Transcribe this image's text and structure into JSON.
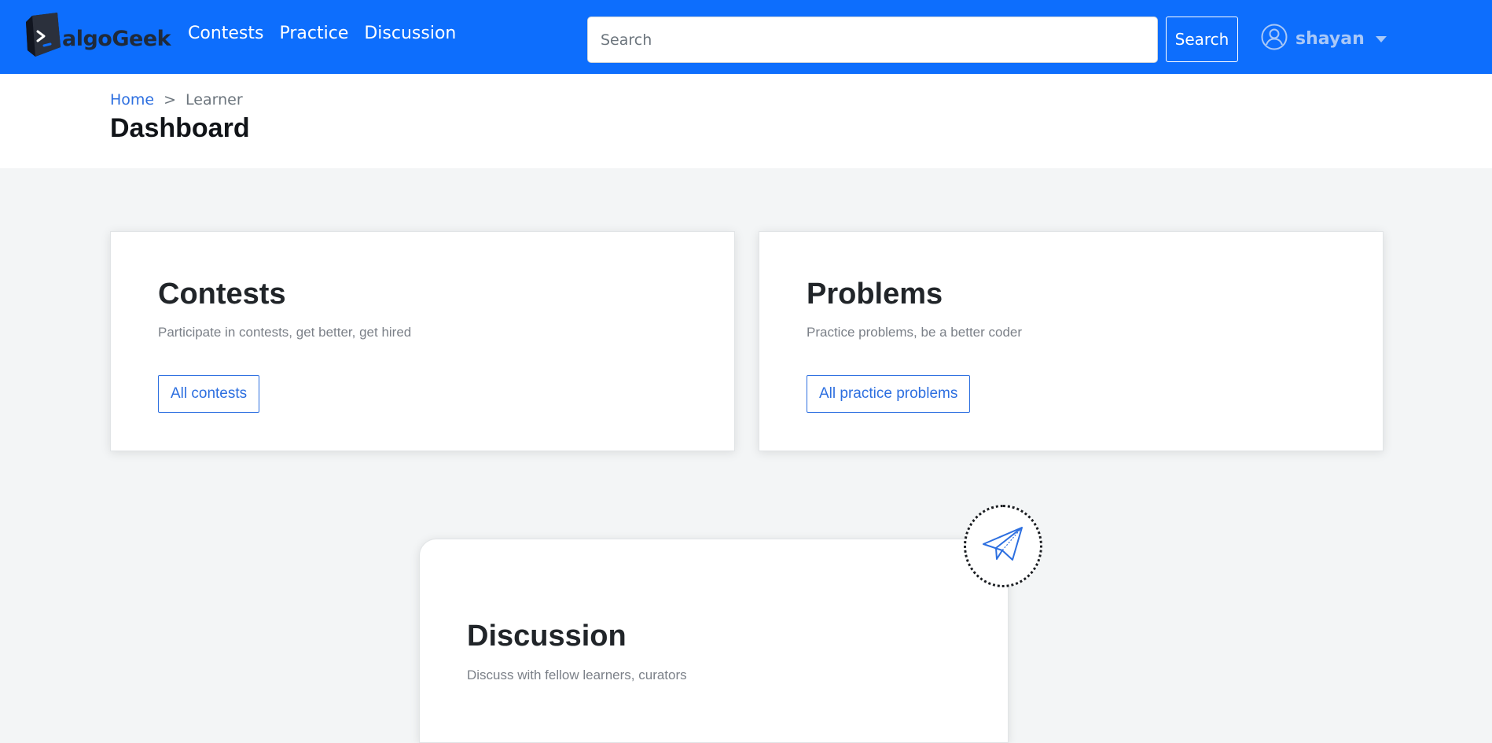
{
  "navbar": {
    "brand": "algoGeek",
    "links": [
      "Contests",
      "Practice",
      "Discussion"
    ],
    "search_placeholder": "Search",
    "search_button": "Search",
    "user_name": "shayan"
  },
  "breadcrumb": {
    "home": "Home",
    "separator": ">",
    "current": "Learner"
  },
  "page_title": "Dashboard",
  "cards": {
    "contests": {
      "title": "Contests",
      "text": "Participate in contests, get better, get hired",
      "button": "All contests"
    },
    "problems": {
      "title": "Problems",
      "text": "Practice problems, be a better coder",
      "button": "All practice problems"
    },
    "discussion": {
      "title": "Discussion",
      "text": "Discuss with fellow learners, curators"
    }
  },
  "colors": {
    "navbar": "#0d6efd",
    "accent": "#2d6fe0",
    "page_background": "#f3f5f6"
  },
  "icons": {
    "brand": "terminal-logo-icon",
    "user": "user-circle-icon",
    "discussion": "paper-plane-icon"
  }
}
